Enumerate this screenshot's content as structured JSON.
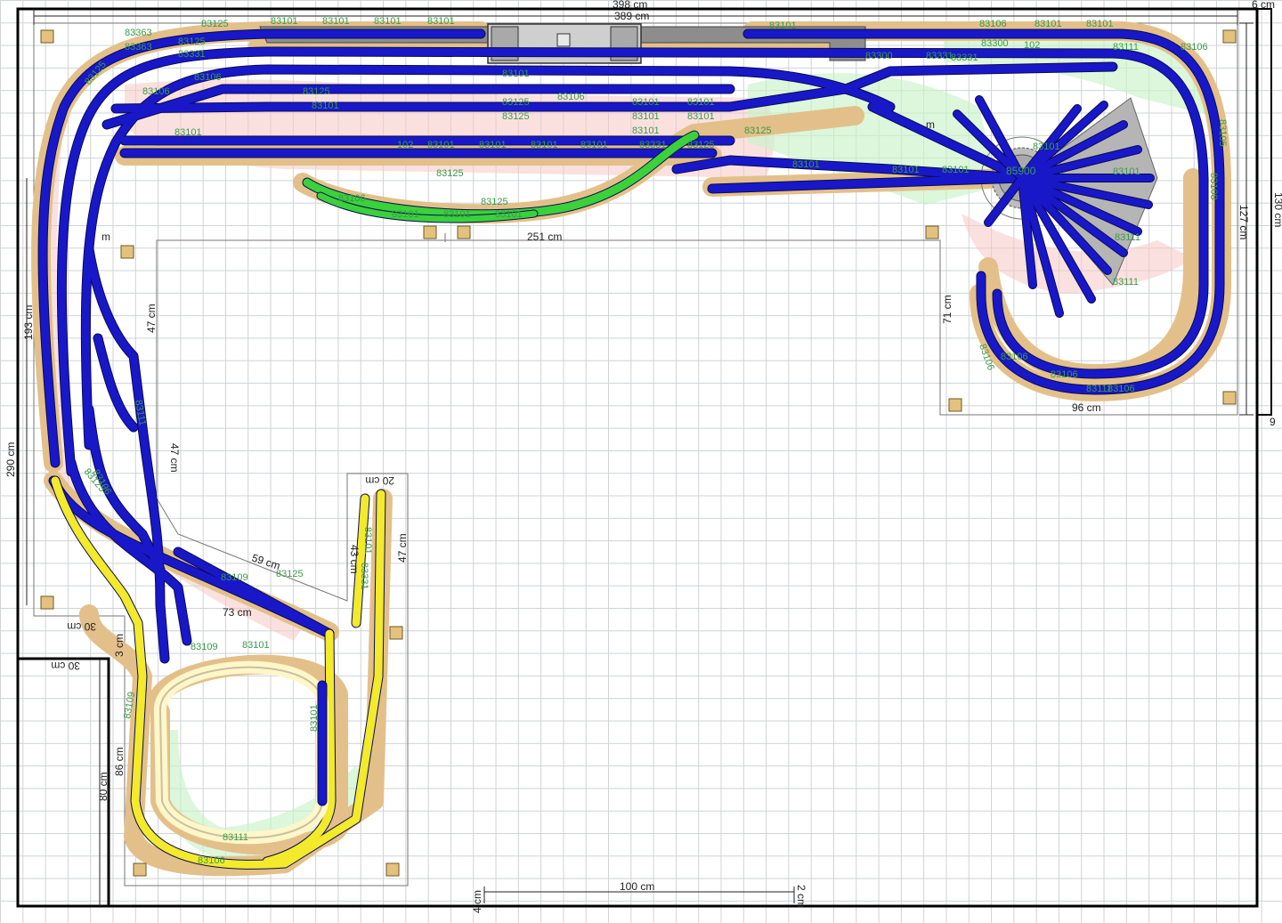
{
  "dimensions": {
    "room_width_outer": "398 cm",
    "room_width_inner": "389 cm",
    "right_offset": "6 cm",
    "right_height": "130 cm",
    "right_inner_height": "127 cm",
    "right_small": "9",
    "left_height": "290 cm",
    "left_inner": "193 cm",
    "leg_upper": "47 cm",
    "leg_middle": "47 cm",
    "leg_right": "47 cm",
    "leg_right_small": "43 cm",
    "top_stub": "20 cm",
    "diag_long": "59 cm",
    "diag_short": "73 cm",
    "bottom_lower": "30 cm",
    "bottom_corner": "30 cm",
    "left_loop_height": "86 cm",
    "left_wall": "80 cm",
    "left_small": "3 cm",
    "center_inner": "251 cm",
    "right_module_height": "71 cm",
    "right_module_width": "96 cm",
    "scale_bar": "100 cm",
    "scale_left": "4 cm",
    "scale_right": "2 cm",
    "unit_m": "m",
    "unit_m2": "m"
  },
  "turntable_label": "85900",
  "track_labels": [
    "83101",
    "83101",
    "83101",
    "83101",
    "83125",
    "83363",
    "83125",
    "83331",
    "83125",
    "83106",
    "83106",
    "83125",
    "83101",
    "83125",
    "83125",
    "83101",
    "83101",
    "83101",
    "83101",
    "83101",
    "83125",
    "83331",
    "83101",
    "83101",
    "83101",
    "83101",
    "83125",
    "83101",
    "83106",
    "83106",
    "83125",
    "83101",
    "83101",
    "83101",
    "102",
    "83125",
    "83106",
    "83101",
    "83111",
    "83106",
    "83106",
    "83106",
    "83106",
    "83111",
    "83101",
    "83111",
    "83125",
    "83109",
    "83101",
    "83101",
    "83331",
    "83101",
    "83106",
    "83109",
    "83111",
    "83101",
    "83101",
    "102",
    "83331",
    "83125",
    "83363",
    "83101",
    "83106",
    "83109",
    "83111",
    "83101",
    "83101",
    "83101",
    "83101",
    "83300",
    "83300",
    "83331",
    "83111",
    "83106",
    "83105",
    "83108"
  ],
  "colors": {
    "track": "#1818c8",
    "bed": "#e3c08a",
    "yellow_track": "#f2ea2a",
    "green_track": "#3ad13a",
    "station": "#8a8a8a"
  }
}
